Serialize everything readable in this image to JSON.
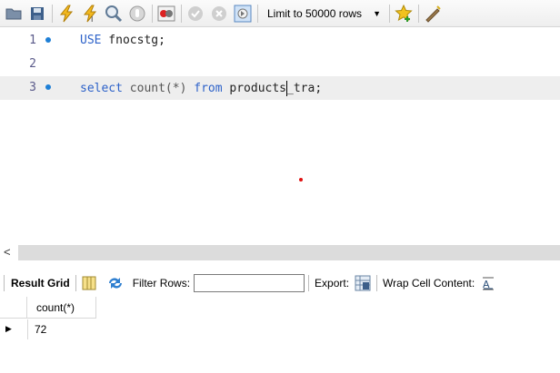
{
  "toolbar": {
    "icons": [
      "open-folder-icon",
      "save-icon",
      "execute-icon",
      "execute-current-icon",
      "explain-icon",
      "stop-icon",
      "toggle-error-icon",
      "commit-icon",
      "rollback-icon",
      "autocommit-icon",
      "add-snippet-icon",
      "beautify-icon"
    ],
    "limit_label": "Limit to 50000 rows"
  },
  "editor": {
    "lines": [
      {
        "number": "1",
        "has_marker": true,
        "text": "USE fnocstg;"
      },
      {
        "number": "2",
        "has_marker": false,
        "text": ""
      },
      {
        "number": "3",
        "has_marker": true,
        "text": "select count(*) from products_tra;"
      }
    ],
    "line1": {
      "kw": "USE",
      "rest": " fnocstg;"
    },
    "line3": {
      "kw1": "select",
      "fn": " count(*) ",
      "kw2": "from",
      "before_cursor": " products",
      "after_cursor": "_tra;"
    }
  },
  "results": {
    "result_grid_label": "Result Grid",
    "filter_label": "Filter Rows:",
    "filter_value": "",
    "export_label": "Export:",
    "wrap_label": "Wrap Cell Content:",
    "columns": [
      "count(*)"
    ],
    "rows": [
      [
        "72"
      ]
    ]
  },
  "colors": {
    "keyword": "#2d62c9",
    "marker": "#1e7fd6",
    "current_line": "#eeeeee"
  }
}
